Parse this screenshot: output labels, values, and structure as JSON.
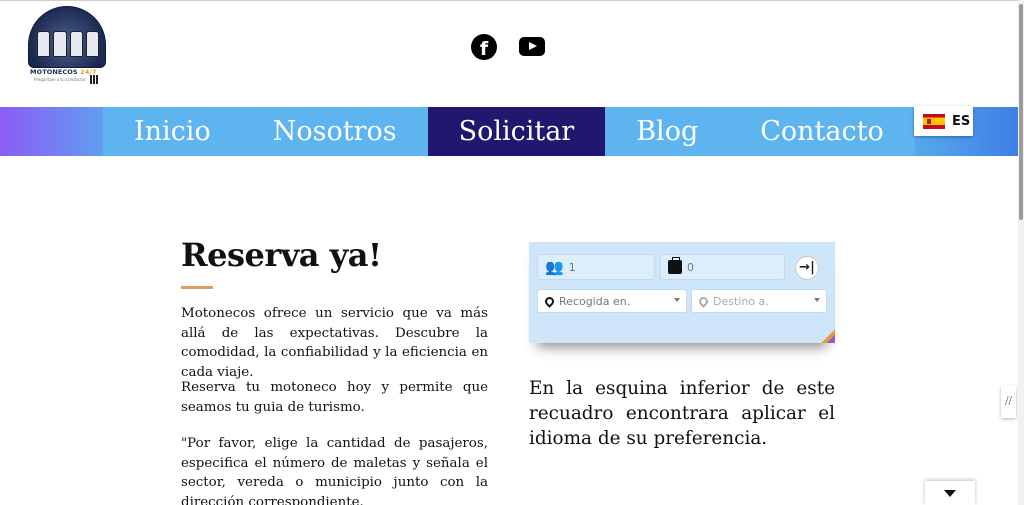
{
  "logo": {
    "name_main": "MOTONECOS",
    "name_accent": "24/7",
    "subtitle": "Pregúntale a tu conductor"
  },
  "nav": {
    "items": [
      {
        "label": "Inicio",
        "active": false
      },
      {
        "label": "Nosotros",
        "active": false
      },
      {
        "label": "Solicitar",
        "active": true
      },
      {
        "label": "Blog",
        "active": false
      },
      {
        "label": "Contacto",
        "active": false
      }
    ]
  },
  "language": {
    "code": "ES",
    "flag": "spain-flag"
  },
  "content": {
    "heading": "Reserva ya!",
    "paragraph_1": "Motonecos ofrece un servicio que va más allá de las expectativas. Descubre la comodidad, la confiabilidad y la eficiencia en cada viaje.",
    "paragraph_2": "Reserva tu motoneco hoy y permite que seamos tu guia de turismo.",
    "paragraph_3": "\"Por favor, elige la cantidad de pasajeros, especifica el número de maletas y señala el sector, vereda o municipio junto con la dirección correspondiente.",
    "note": "En la esquina inferior de este recuadro encontrara aplicar el idioma de su preferencia."
  },
  "booking": {
    "passengers": "1",
    "luggage": "0",
    "pickup_placeholder": "Recogida en.",
    "destination_placeholder": "Destino a.",
    "submit_symbol": "→|"
  },
  "colors": {
    "nav_bg": "#5db4ee",
    "nav_active": "#22176e",
    "accent_rule": "#d9a061",
    "widget_bg": "#cfe6fa"
  }
}
